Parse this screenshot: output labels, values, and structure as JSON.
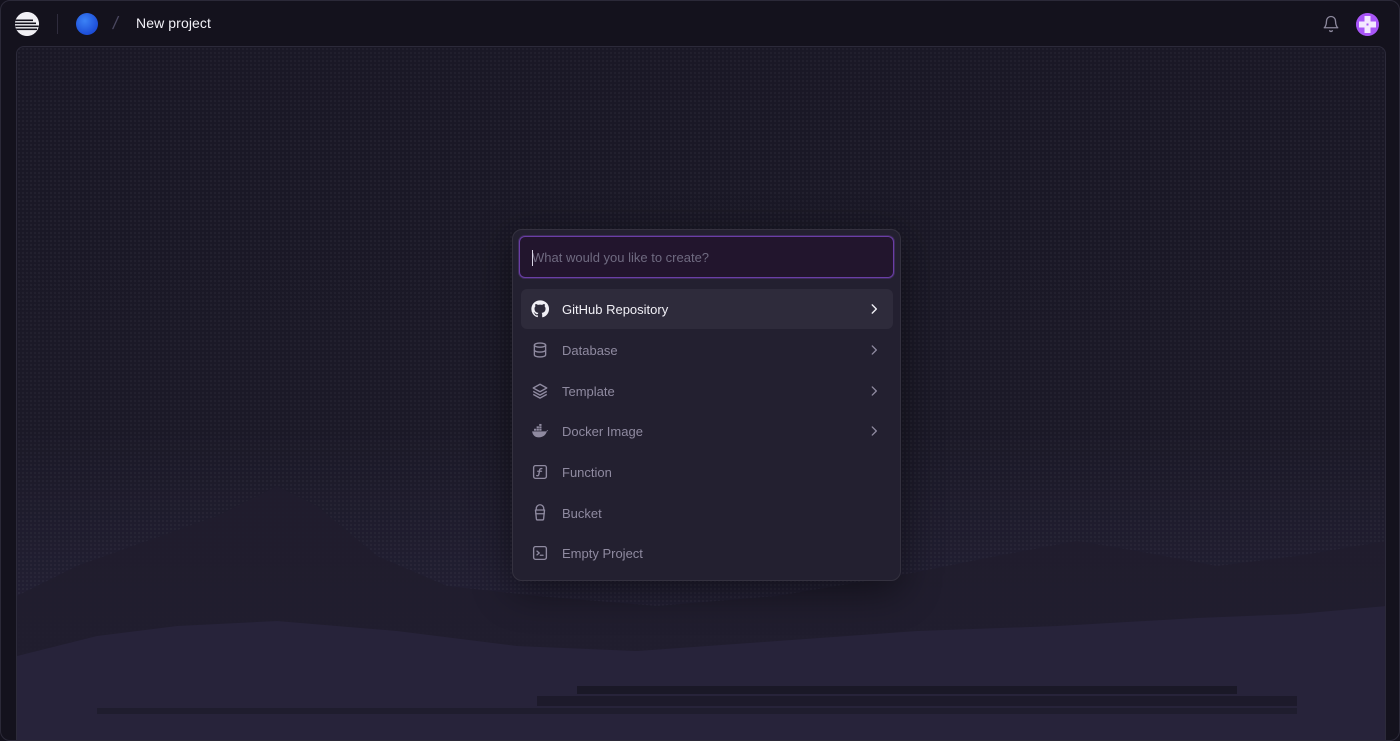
{
  "header": {
    "title": "New project",
    "logo_icon": "railway-logo-icon",
    "workspace_avatar_color": "#2f6fe6",
    "bell_icon": "bell-icon",
    "user_avatar_color": "#a855f7"
  },
  "modal": {
    "search": {
      "placeholder": "What would you like to create?",
      "value": ""
    },
    "accent_color": "#6a3ea6",
    "items": [
      {
        "label": "GitHub Repository",
        "icon": "github-icon",
        "has_submenu": true,
        "active": true
      },
      {
        "label": "Database",
        "icon": "database-icon",
        "has_submenu": true,
        "active": false
      },
      {
        "label": "Template",
        "icon": "layers-icon",
        "has_submenu": true,
        "active": false
      },
      {
        "label": "Docker Image",
        "icon": "docker-icon",
        "has_submenu": true,
        "active": false
      },
      {
        "label": "Function",
        "icon": "function-icon",
        "has_submenu": false,
        "active": false
      },
      {
        "label": "Bucket",
        "icon": "bucket-icon",
        "has_submenu": false,
        "active": false
      },
      {
        "label": "Empty Project",
        "icon": "terminal-icon",
        "has_submenu": false,
        "active": false
      }
    ]
  }
}
